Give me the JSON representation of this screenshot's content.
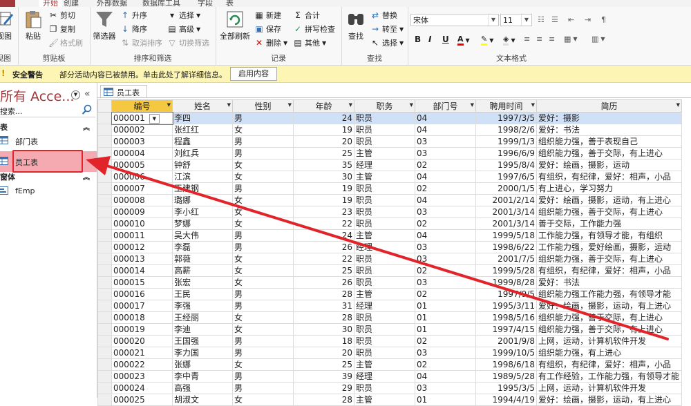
{
  "tabs": {
    "home": "开始",
    "t2": "创建",
    "t3": "外部数据",
    "t4": "数据库工具",
    "t5": "字段",
    "t6": "表"
  },
  "ribbon": {
    "view": {
      "label": "视图",
      "group": "视图"
    },
    "clipboard": {
      "paste": "粘贴",
      "cut": "剪切",
      "copy": "复制",
      "painter": "格式刷",
      "group": "剪贴板"
    },
    "sort": {
      "filter": "筛选器",
      "asc": "升序",
      "desc": "降序",
      "remove_sort": "取消排序",
      "selection": "选择",
      "advanced": "高级",
      "toggle_filter": "切换筛选",
      "group": "排序和筛选"
    },
    "records": {
      "refresh_all": "全部刷新",
      "new": "新建",
      "save": "保存",
      "delete": "删除",
      "totals": "合计",
      "spelling": "拼写检查",
      "more": "其他",
      "group": "记录"
    },
    "find": {
      "find": "查找",
      "replace": "替换",
      "goto": "转至",
      "select": "选择",
      "group": "查找"
    },
    "text_format": {
      "font": "宋体",
      "size": "11",
      "bold": "B",
      "italic": "I",
      "underline": "U",
      "group": "文本格式"
    }
  },
  "security_bar": {
    "title": "安全警告",
    "message": "部分活动内容已被禁用。单击此处了解详细信息。",
    "button": "启用内容"
  },
  "nav": {
    "title": "所有 Acce...",
    "search_placeholder": "搜索...",
    "sections": [
      {
        "label": "表",
        "items": [
          "部门表",
          "员工表"
        ]
      },
      {
        "label": "窗体",
        "items": [
          "fEmp"
        ]
      }
    ]
  },
  "doc_tab": "员工表",
  "colors": {
    "accent": "#a4373a",
    "selected_item": "#f5a9b0",
    "annotation_red": "#e0242a",
    "header_selected": "#f5c842"
  },
  "table": {
    "columns": [
      "编号",
      "姓名",
      "性别",
      "年龄",
      "职务",
      "部门号",
      "聘用时间",
      "简历"
    ],
    "rows": [
      [
        "000001",
        "李四",
        "男",
        "24",
        "职员",
        "04",
        "1997/3/5",
        "爱好：摄影"
      ],
      [
        "000002",
        "张红红",
        "女",
        "19",
        "职员",
        "04",
        "1998/2/6",
        "爱好：书法"
      ],
      [
        "000003",
        "程鑫",
        "男",
        "20",
        "职员",
        "03",
        "1999/1/3",
        "组织能力强，善于表现自己"
      ],
      [
        "000004",
        "刘红兵",
        "男",
        "25",
        "主管",
        "03",
        "1996/6/9",
        "组织能力强，善于交际，有上进心"
      ],
      [
        "000005",
        "钟舒",
        "女",
        "35",
        "经理",
        "02",
        "1995/8/4",
        "爱好：绘画，摄影，运动"
      ],
      [
        "000006",
        "江滨",
        "女",
        "30",
        "主管",
        "04",
        "1997/6/5",
        "有组织，有纪律，爱好：相声，小品"
      ],
      [
        "000007",
        "王建钢",
        "男",
        "19",
        "职员",
        "02",
        "2000/1/5",
        "有上进心，学习努力"
      ],
      [
        "000008",
        "璐娜",
        "女",
        "19",
        "职员",
        "04",
        "2001/2/14",
        "爱好：绘画，摄影，运动，有上进心"
      ],
      [
        "000009",
        "李小红",
        "女",
        "23",
        "职员",
        "03",
        "2001/3/14",
        "组织能力强，善于交际，有上进心"
      ],
      [
        "000010",
        "梦娜",
        "女",
        "22",
        "职员",
        "02",
        "2001/3/14",
        "善于交际，工作能力强"
      ],
      [
        "000011",
        "吴大伟",
        "男",
        "24",
        "主管",
        "04",
        "1999/5/18",
        "工作能力强，有领导才能，有组织"
      ],
      [
        "000012",
        "李磊",
        "男",
        "26",
        "经理",
        "03",
        "1998/6/22",
        "工作能力强，爱好绘画，摄影，运动"
      ],
      [
        "000013",
        "郭薇",
        "女",
        "22",
        "职员",
        "03",
        "2001/7/5",
        "组织能力强，善于交际，有上进心"
      ],
      [
        "000014",
        "高薪",
        "女",
        "25",
        "职员",
        "02",
        "1999/5/28",
        "有组织，有纪律，爱好：相声，小品"
      ],
      [
        "000015",
        "张宏",
        "女",
        "26",
        "职员",
        "03",
        "1999/8/28",
        "爱好：书法"
      ],
      [
        "000016",
        "王民",
        "男",
        "28",
        "主管",
        "02",
        "1997/9/5",
        "组织能力强工作能力强，有领导才能"
      ],
      [
        "000017",
        "李强",
        "男",
        "31",
        "经理",
        "01",
        "1995/3/11",
        "爱好：绘画，摄影，运动，有上进心"
      ],
      [
        "000018",
        "王经丽",
        "女",
        "28",
        "职员",
        "01",
        "1998/5/16",
        "组织能力强，善于交际，有上进心"
      ],
      [
        "000019",
        "李迪",
        "女",
        "30",
        "职员",
        "01",
        "1997/4/15",
        "组织能力强，善于交际，有上进心"
      ],
      [
        "000020",
        "王国强",
        "男",
        "18",
        "职员",
        "02",
        "2001/9/8",
        "上网，运动，计算机软件开发"
      ],
      [
        "000021",
        "李力国",
        "男",
        "20",
        "职员",
        "03",
        "1999/10/5",
        "组织能力强，有上进心"
      ],
      [
        "000022",
        "张娜",
        "女",
        "25",
        "主管",
        "02",
        "1998/6/18",
        "有组织，有纪律，爱好：相声，小品"
      ],
      [
        "000023",
        "李中青",
        "男",
        "39",
        "经理",
        "04",
        "1989/5/28",
        "有工作经验，工作能力强，有领导才能"
      ],
      [
        "000024",
        "高强",
        "男",
        "29",
        "职员",
        "03",
        "1995/3/5",
        "上网，运动，计算机软件开发"
      ],
      [
        "000025",
        "胡淑文",
        "女",
        "28",
        "主管",
        "01",
        "1994/4/19",
        "爱好：绘画，摄影，运动，有上进心"
      ]
    ]
  }
}
